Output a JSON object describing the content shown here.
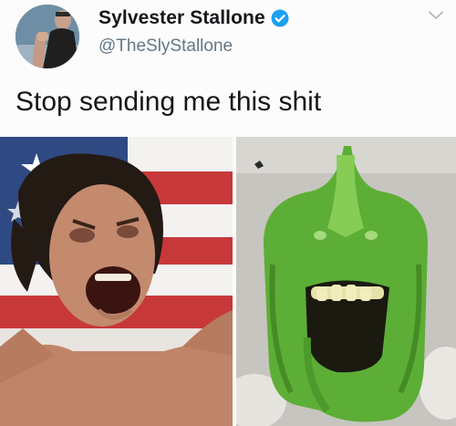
{
  "tweet": {
    "display_name": "Sylvester Stallone",
    "handle": "@TheSlyStallone",
    "text": "Stop sending me this shit",
    "verified": true
  },
  "media": {
    "left_image": "photo-screaming-man-flag",
    "right_image": "photo-green-pepper-face"
  },
  "icons": {
    "verified": "verified-badge-icon",
    "menu": "chevron-down-icon"
  },
  "colors": {
    "verified_blue": "#1da1f2",
    "text_primary": "#14171a",
    "text_secondary": "#657786"
  }
}
